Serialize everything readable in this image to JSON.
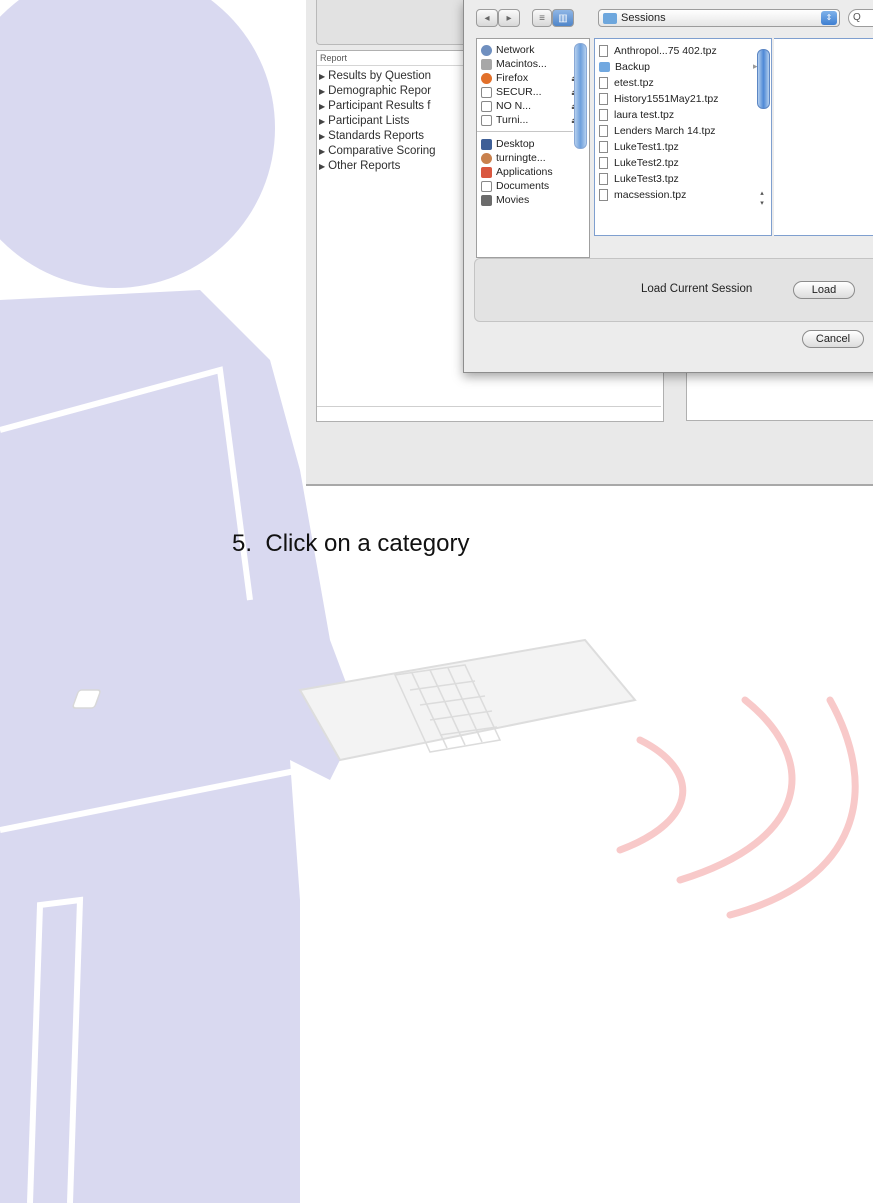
{
  "report_panel": {
    "header": "Report",
    "items": [
      {
        "label": "Results by Question"
      },
      {
        "label": "Demographic Repor"
      },
      {
        "label": "Participant Results f"
      },
      {
        "label": "Participant Lists"
      },
      {
        "label": "Standards Reports"
      },
      {
        "label": "Comparative Scoring"
      },
      {
        "label": "Other Reports"
      }
    ]
  },
  "dialog": {
    "nav_back": "◂",
    "nav_forward": "▸",
    "view_list": "≡",
    "view_columns": "▥",
    "location": "Sessions",
    "search_icon": "search-icon",
    "search_glyph": "Q",
    "sidebar": [
      {
        "label": "Network",
        "icon": "network-icon",
        "eject": ""
      },
      {
        "label": "Macintos...",
        "icon": "hard-drive-icon",
        "eject": ""
      },
      {
        "label": "Firefox",
        "icon": "firefox-icon",
        "eject": "⏏"
      },
      {
        "label": "SECUR...",
        "icon": "disk-icon",
        "eject": "⏏"
      },
      {
        "label": "NO N...",
        "icon": "disk-icon",
        "eject": "⏏"
      },
      {
        "label": "Turni...",
        "icon": "disk-icon",
        "eject": "⏏"
      },
      {
        "label": "Desktop",
        "icon": "desktop-icon",
        "eject": ""
      },
      {
        "label": "turningte...",
        "icon": "home-icon",
        "eject": ""
      },
      {
        "label": "Applications",
        "icon": "applications-icon",
        "eject": ""
      },
      {
        "label": "Documents",
        "icon": "documents-icon",
        "eject": ""
      },
      {
        "label": "Movies",
        "icon": "movies-icon",
        "eject": ""
      }
    ],
    "files": [
      {
        "name": "Anthropol...75 402.tpz",
        "type": "file"
      },
      {
        "name": "Backup",
        "type": "folder"
      },
      {
        "name": "etest.tpz",
        "type": "file"
      },
      {
        "name": "History1551May21.tpz",
        "type": "file"
      },
      {
        "name": "laura test.tpz",
        "type": "file"
      },
      {
        "name": "Lenders March 14.tpz",
        "type": "file"
      },
      {
        "name": "LukeTest1.tpz",
        "type": "file"
      },
      {
        "name": "LukeTest2.tpz",
        "type": "file"
      },
      {
        "name": "LukeTest3.tpz",
        "type": "file"
      },
      {
        "name": "macsession.tpz",
        "type": "file"
      }
    ],
    "load_current_session_label": "Load Current Session",
    "load_button": "Load",
    "cancel_button": "Cancel"
  },
  "instruction": {
    "number": "5.",
    "text": "Click on a category"
  },
  "colors": {
    "figure": "#d7d7ef",
    "signal_waves": "#f6c5c5",
    "selection_blue": "#4d88d6"
  }
}
